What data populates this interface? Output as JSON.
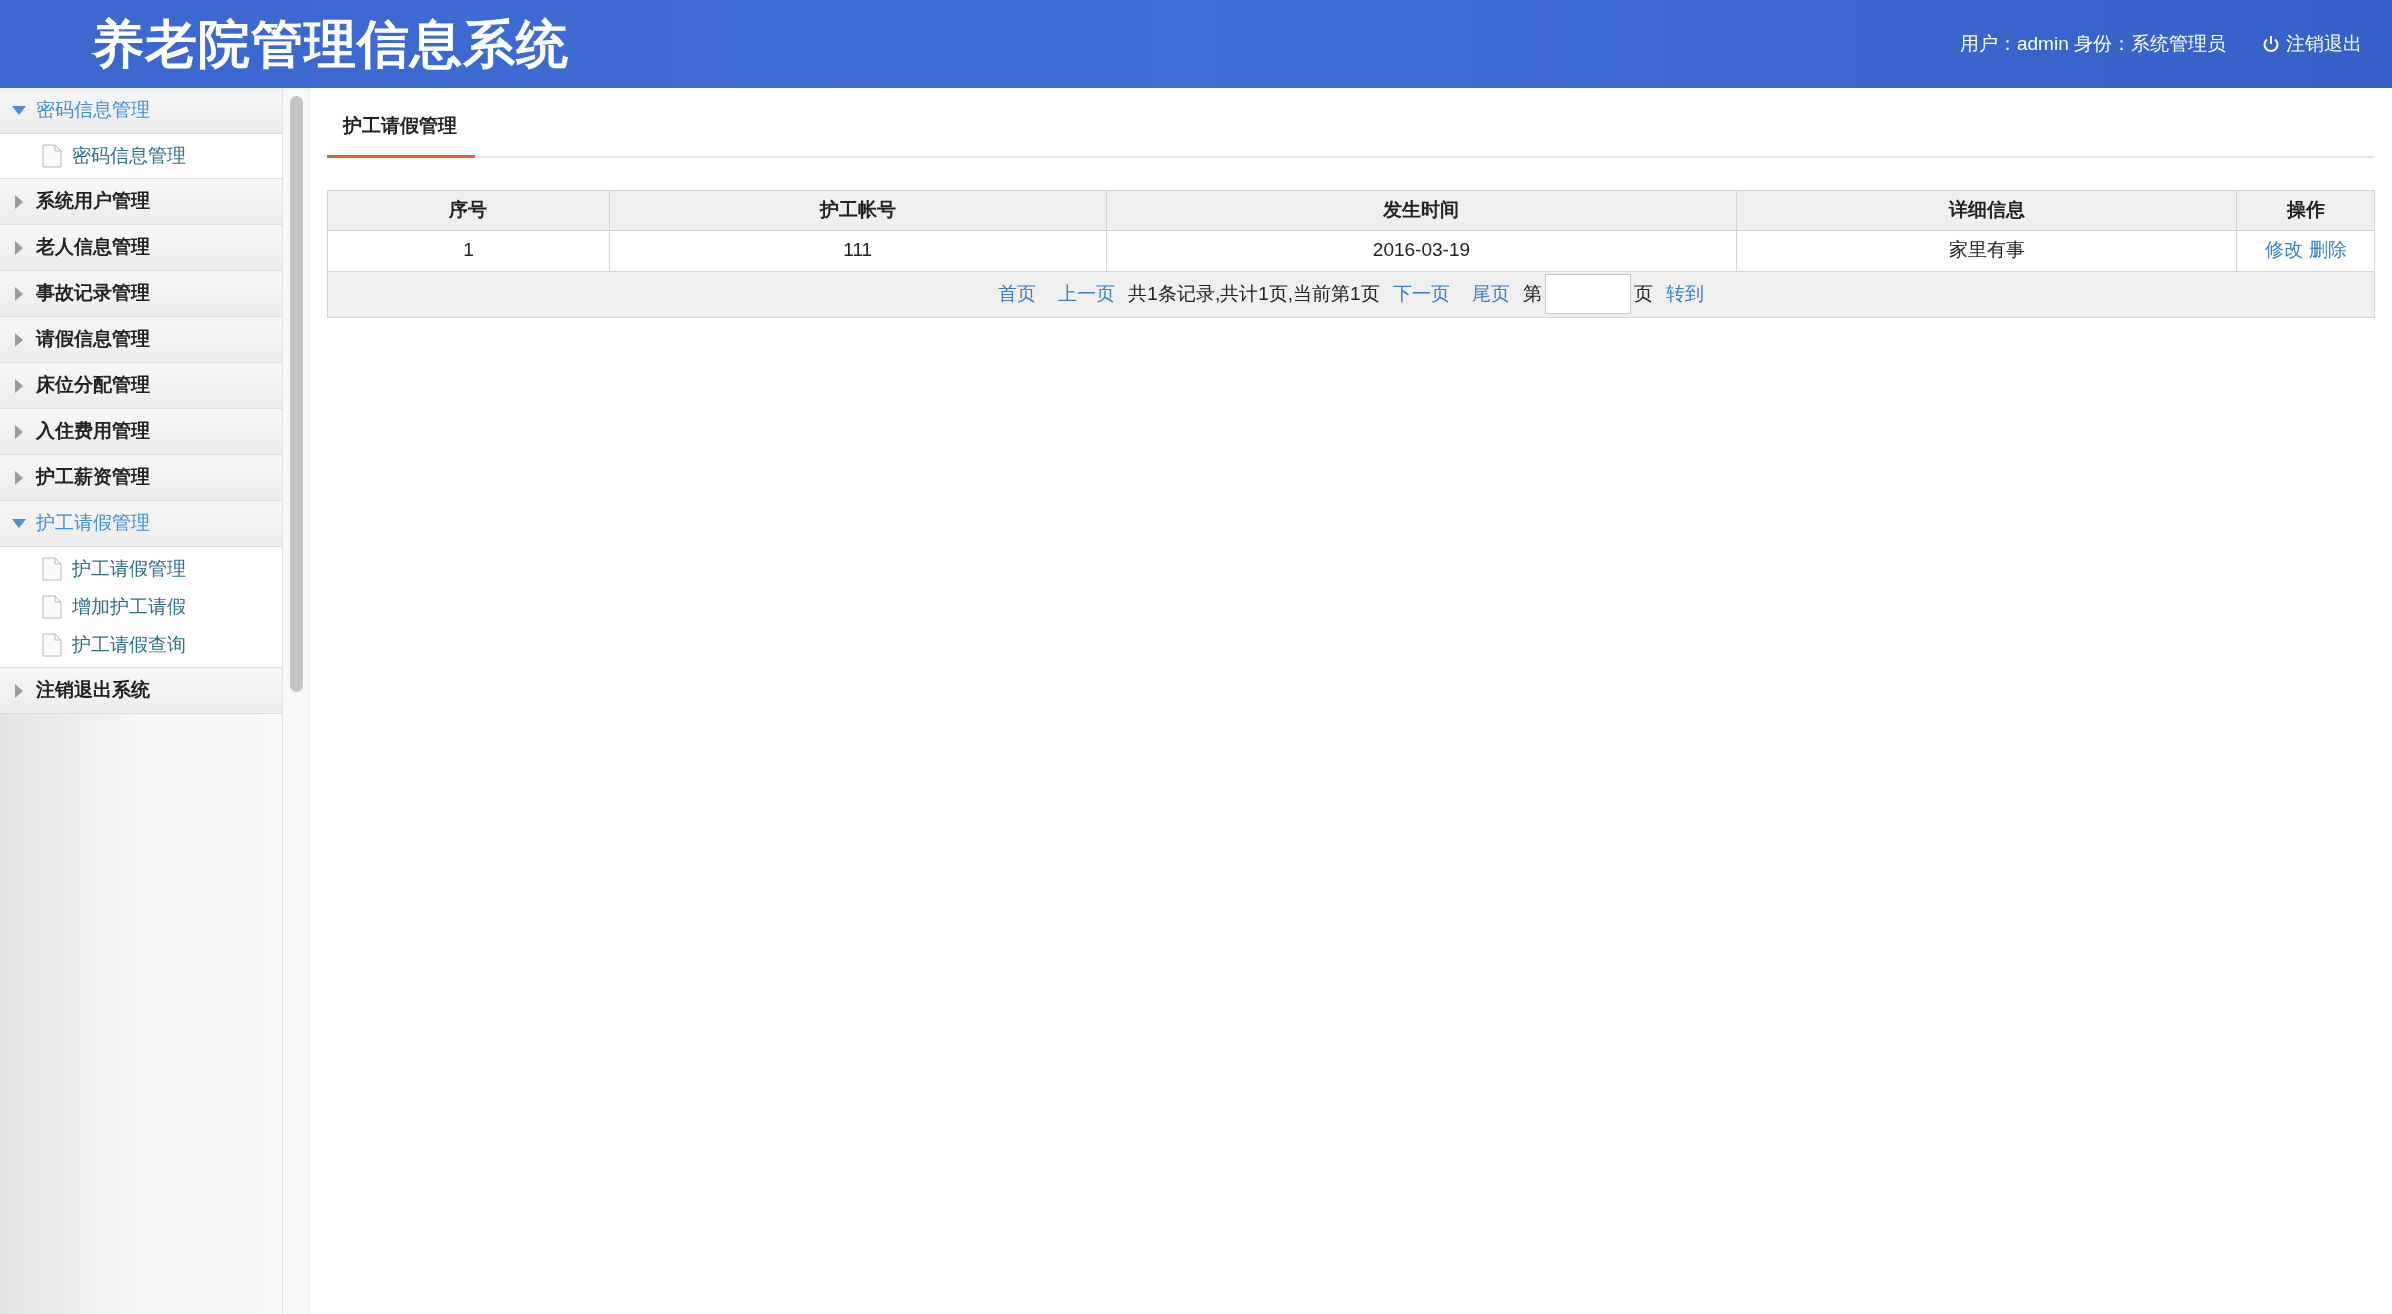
{
  "header": {
    "title": "养老院管理信息系统",
    "user_info": "用户：admin 身份：系统管理员",
    "logout": "注销退出"
  },
  "sidebar": {
    "groups": [
      {
        "label": "密码信息管理",
        "expanded": true,
        "children": [
          {
            "label": "密码信息管理"
          }
        ]
      },
      {
        "label": "系统用户管理",
        "expanded": false
      },
      {
        "label": "老人信息管理",
        "expanded": false
      },
      {
        "label": "事故记录管理",
        "expanded": false
      },
      {
        "label": "请假信息管理",
        "expanded": false
      },
      {
        "label": "床位分配管理",
        "expanded": false
      },
      {
        "label": "入住费用管理",
        "expanded": false
      },
      {
        "label": "护工薪资管理",
        "expanded": false
      },
      {
        "label": "护工请假管理",
        "expanded": true,
        "children": [
          {
            "label": "护工请假管理"
          },
          {
            "label": "增加护工请假"
          },
          {
            "label": "护工请假查询"
          }
        ]
      },
      {
        "label": "注销退出系统",
        "expanded": false
      }
    ]
  },
  "tab": {
    "label": "护工请假管理"
  },
  "table": {
    "columns": [
      "序号",
      "护工帐号",
      "发生时间",
      "详细信息",
      "操作"
    ],
    "rows": [
      {
        "cells": [
          "1",
          "111",
          "2016-03-19",
          "家里有事"
        ],
        "actions": [
          "修改",
          "删除"
        ]
      }
    ]
  },
  "pager": [
    {
      "kind": "link",
      "text": "首页"
    },
    {
      "kind": "link",
      "text": "上一页"
    },
    {
      "kind": "text",
      "text": "共1条记录,共计1页,当前第1页"
    },
    {
      "kind": "link",
      "text": "下一页"
    },
    {
      "kind": "link",
      "text": "尾页"
    },
    {
      "kind": "text",
      "text": "第"
    },
    {
      "kind": "input"
    },
    {
      "kind": "text",
      "text": "页"
    },
    {
      "kind": "link",
      "text": "转到"
    }
  ]
}
